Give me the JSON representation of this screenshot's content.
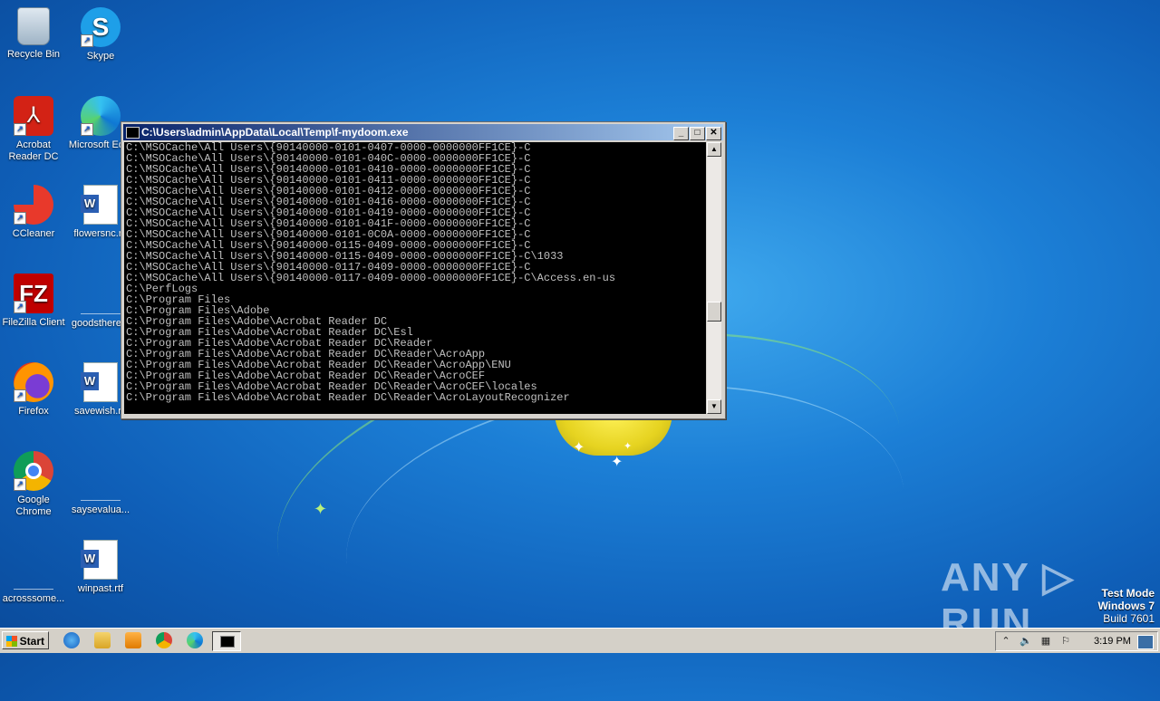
{
  "desktop": {
    "icons": [
      {
        "label": "Recycle Bin"
      },
      {
        "label": "Skype"
      },
      {
        "label": "Acrobat Reader DC"
      },
      {
        "label": "Microsoft Ed..."
      },
      {
        "label": "CCleaner"
      },
      {
        "label": "flowersnc.rtf"
      },
      {
        "label": "FileZilla Client"
      },
      {
        "label": "goodsthere..."
      },
      {
        "label": "Firefox"
      },
      {
        "label": "savewish.rtf"
      },
      {
        "label": "Google Chrome"
      },
      {
        "label": "saysevalua..."
      },
      {
        "label": "acrosssome..."
      },
      {
        "label": "winpast.rtf"
      }
    ]
  },
  "window": {
    "title": "C:\\Users\\admin\\AppData\\Local\\Temp\\f-mydoom.exe",
    "minimize_label": "_",
    "maximize_label": "□",
    "close_label": "✕",
    "console_lines": [
      "C:\\MSOCache\\All Users\\{90140000-0101-0407-0000-0000000FF1CE}-C",
      "C:\\MSOCache\\All Users\\{90140000-0101-040C-0000-0000000FF1CE}-C",
      "C:\\MSOCache\\All Users\\{90140000-0101-0410-0000-0000000FF1CE}-C",
      "C:\\MSOCache\\All Users\\{90140000-0101-0411-0000-0000000FF1CE}-C",
      "C:\\MSOCache\\All Users\\{90140000-0101-0412-0000-0000000FF1CE}-C",
      "C:\\MSOCache\\All Users\\{90140000-0101-0416-0000-0000000FF1CE}-C",
      "C:\\MSOCache\\All Users\\{90140000-0101-0419-0000-0000000FF1CE}-C",
      "C:\\MSOCache\\All Users\\{90140000-0101-041F-0000-0000000FF1CE}-C",
      "C:\\MSOCache\\All Users\\{90140000-0101-0C0A-0000-0000000FF1CE}-C",
      "C:\\MSOCache\\All Users\\{90140000-0115-0409-0000-0000000FF1CE}-C",
      "C:\\MSOCache\\All Users\\{90140000-0115-0409-0000-0000000FF1CE}-C\\1033",
      "C:\\MSOCache\\All Users\\{90140000-0117-0409-0000-0000000FF1CE}-C",
      "C:\\MSOCache\\All Users\\{90140000-0117-0409-0000-0000000FF1CE}-C\\Access.en-us",
      "C:\\PerfLogs",
      "C:\\Program Files",
      "C:\\Program Files\\Adobe",
      "C:\\Program Files\\Adobe\\Acrobat Reader DC",
      "C:\\Program Files\\Adobe\\Acrobat Reader DC\\Esl",
      "C:\\Program Files\\Adobe\\Acrobat Reader DC\\Reader",
      "C:\\Program Files\\Adobe\\Acrobat Reader DC\\Reader\\AcroApp",
      "C:\\Program Files\\Adobe\\Acrobat Reader DC\\Reader\\AcroApp\\ENU",
      "C:\\Program Files\\Adobe\\Acrobat Reader DC\\Reader\\AcroCEF",
      "C:\\Program Files\\Adobe\\Acrobat Reader DC\\Reader\\AcroCEF\\locales",
      "C:\\Program Files\\Adobe\\Acrobat Reader DC\\Reader\\AcroLayoutRecognizer"
    ]
  },
  "watermark": {
    "brand": "ANY ▷ RUN",
    "test_mode": "Test Mode",
    "os": "Windows 7",
    "build": "Build 7601"
  },
  "taskbar": {
    "start_label": "Start",
    "clock": "3:19 PM"
  }
}
